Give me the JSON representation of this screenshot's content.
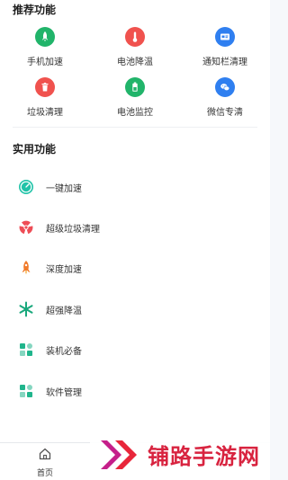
{
  "recommended": {
    "title": "推荐功能",
    "items": [
      {
        "label": "手机加速",
        "icon": "rocket-icon",
        "color": "#21b46a"
      },
      {
        "label": "电池降温",
        "icon": "thermometer-icon",
        "color": "#f0524e"
      },
      {
        "label": "通知栏清理",
        "icon": "notification-card-icon",
        "color": "#2f7ff0"
      },
      {
        "label": "垃圾清理",
        "icon": "trash-icon",
        "color": "#f0524e"
      },
      {
        "label": "电池监控",
        "icon": "battery-icon",
        "color": "#21b46a"
      },
      {
        "label": "微信专清",
        "icon": "wechat-icon",
        "color": "#2f7ff0"
      }
    ]
  },
  "tools": {
    "title": "实用功能",
    "items": [
      {
        "label": "一键加速",
        "icon": "speedometer-icon",
        "color": "#20c3a8"
      },
      {
        "label": "超级垃圾清理",
        "icon": "radiation-icon",
        "color": "#ee4d56"
      },
      {
        "label": "深度加速",
        "icon": "rocket-icon",
        "color": "#f07a2a"
      },
      {
        "label": "超强降温",
        "icon": "snowflake-icon",
        "color": "#19a87c"
      },
      {
        "label": "装机必备",
        "icon": "apps-grid-icon",
        "color": "#20b58c"
      },
      {
        "label": "软件管理",
        "icon": "apps-grid-icon",
        "color": "#20b58c"
      }
    ]
  },
  "bottom_nav": {
    "home_label": "首页",
    "home_icon": "home-icon"
  },
  "watermark": {
    "text": "铺路手游网",
    "color": "#d8233f",
    "icon": "double-chevron-logo-icon"
  }
}
